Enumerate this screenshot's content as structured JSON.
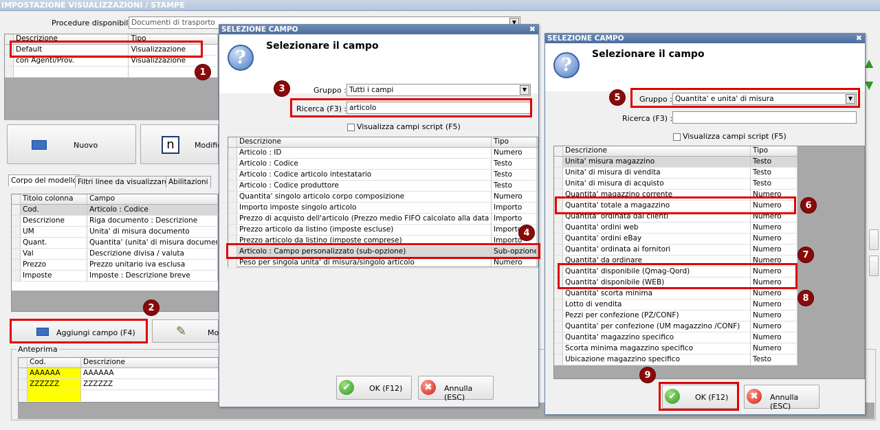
{
  "window": {
    "title": "IMPOSTAZIONE VISUALIZZAZIONI / STAMPE"
  },
  "procedure": {
    "label": "Procedure disponibili :",
    "value": "Documenti di trasporto"
  },
  "models": {
    "headers": [
      "Descrizione",
      "Tipo"
    ],
    "rows": [
      [
        "Default",
        "Visualizzazione"
      ],
      [
        "con Agenti/Prov.",
        "Visualizzazione"
      ]
    ]
  },
  "toolbar": {
    "new_label": "Nuovo",
    "edit_label": "Modifica",
    "edit_glyph": "n"
  },
  "tabs": [
    "Corpo del modello",
    "Filtri linee da visualizzare",
    "Abilitazioni"
  ],
  "columns": {
    "headers": [
      "Titolo colonna",
      "Campo"
    ],
    "rows": [
      [
        "Cod.",
        "Articolo : Codice"
      ],
      [
        "Descrizione",
        "Riga documento : Descrizione"
      ],
      [
        "UM",
        "Unita' di misura documento"
      ],
      [
        "Quant.",
        "Quantita' (unita' di misura documento)"
      ],
      [
        "Val",
        "Descrizione divisa / valuta"
      ],
      [
        "Prezzo",
        "Prezzo unitario iva esclusa"
      ],
      [
        "Imposte",
        "Imposte : Descrizione breve"
      ]
    ]
  },
  "add_field": {
    "label": "Aggiungi campo (F4)",
    "mod_label": "Mo"
  },
  "preview": {
    "title": "Anteprima",
    "headers": [
      "Cod.",
      "Descrizione"
    ],
    "rows": [
      [
        "AAAAAA",
        "AAAAAA"
      ],
      [
        "ZZZZZZ",
        "ZZZZZZ"
      ]
    ]
  },
  "dialog1": {
    "title": "SELEZIONE CAMPO",
    "heading": "Selezionare il campo",
    "group_label": "Gruppo :",
    "group_value": "Tutti i campi",
    "search_label": "Ricerca (F3) :",
    "search_value": "articolo",
    "script_label": "Visualizza campi script (F5)",
    "headers": [
      "Descrizione",
      "Tipo"
    ],
    "rows": [
      [
        "Articolo : ID",
        "Numero"
      ],
      [
        "Articolo : Codice",
        "Testo"
      ],
      [
        "Articolo : Codice articolo intestatario",
        "Testo"
      ],
      [
        "Articolo : Codice produttore",
        "Testo"
      ],
      [
        "Quantita' singolo articolo corpo composizione",
        "Numero"
      ],
      [
        "Importo imposte singolo articolo",
        "Importo"
      ],
      [
        "Prezzo di acquisto dell'articolo (Prezzo medio FIFO calcolato alla data del ...",
        "Importo"
      ],
      [
        "Prezzo articolo da listino (imposte escluse)",
        "Importo"
      ],
      [
        "Prezzo articolo da listino (imposte comprese)",
        "Importo"
      ],
      [
        "Articolo : Campo personalizzato (sub-opzione)",
        "Sub-opzione"
      ],
      [
        "Peso per singola unita' di misura/singolo articolo",
        "Numero"
      ]
    ],
    "ok": "OK (F12)",
    "cancel": "Annulla (ESC)"
  },
  "dialog2": {
    "title": "SELEZIONE CAMPO",
    "heading": "Selezionare il campo",
    "group_label": "Gruppo :",
    "group_value": "Quantita' e unita' di misura",
    "search_label": "Ricerca (F3) :",
    "search_value": "",
    "script_label": "Visualizza campi script (F5)",
    "headers": [
      "Descrizione",
      "Tipo"
    ],
    "rows": [
      [
        "Unita' misura magazzino",
        "Testo"
      ],
      [
        "Unita' di misura di vendita",
        "Testo"
      ],
      [
        "Unita' di misura di acquisto",
        "Testo"
      ],
      [
        "Quantita' magazzino corrente",
        "Numero"
      ],
      [
        "Quantita' totale a magazzino",
        "Numero"
      ],
      [
        "Quantita' ordinata dai clienti",
        "Numero"
      ],
      [
        "Quantita' ordini web",
        "Numero"
      ],
      [
        "Quantita' ordini eBay",
        "Numero"
      ],
      [
        "Quantita' ordinata ai fornitori",
        "Numero"
      ],
      [
        "Quantita' da ordinare",
        "Numero"
      ],
      [
        "Quantita' disponibile (Qmag-Qord)",
        "Numero"
      ],
      [
        "Quantita' disponibile (WEB)",
        "Numero"
      ],
      [
        "Quantita' scorta minima",
        "Numero"
      ],
      [
        "Lotto di vendita",
        "Numero"
      ],
      [
        "Pezzi per confezione (PZ/CONF)",
        "Numero"
      ],
      [
        "Quantita' per confezione (UM magazzino /CONF)",
        "Numero"
      ],
      [
        "Quantita' magazzino specifico",
        "Numero"
      ],
      [
        "Scorta minima magazzino specifico",
        "Numero"
      ],
      [
        "Ubicazione magazzino specifico",
        "Testo"
      ]
    ],
    "ok": "OK (F12)",
    "cancel": "Annulla (ESC)"
  },
  "badges": [
    "1",
    "2",
    "3",
    "4",
    "5",
    "6",
    "7",
    "8",
    "9"
  ],
  "colors": {
    "highlight": "#e00000",
    "badge": "#8a0a0a",
    "preview_yellow": "#ffff00"
  }
}
